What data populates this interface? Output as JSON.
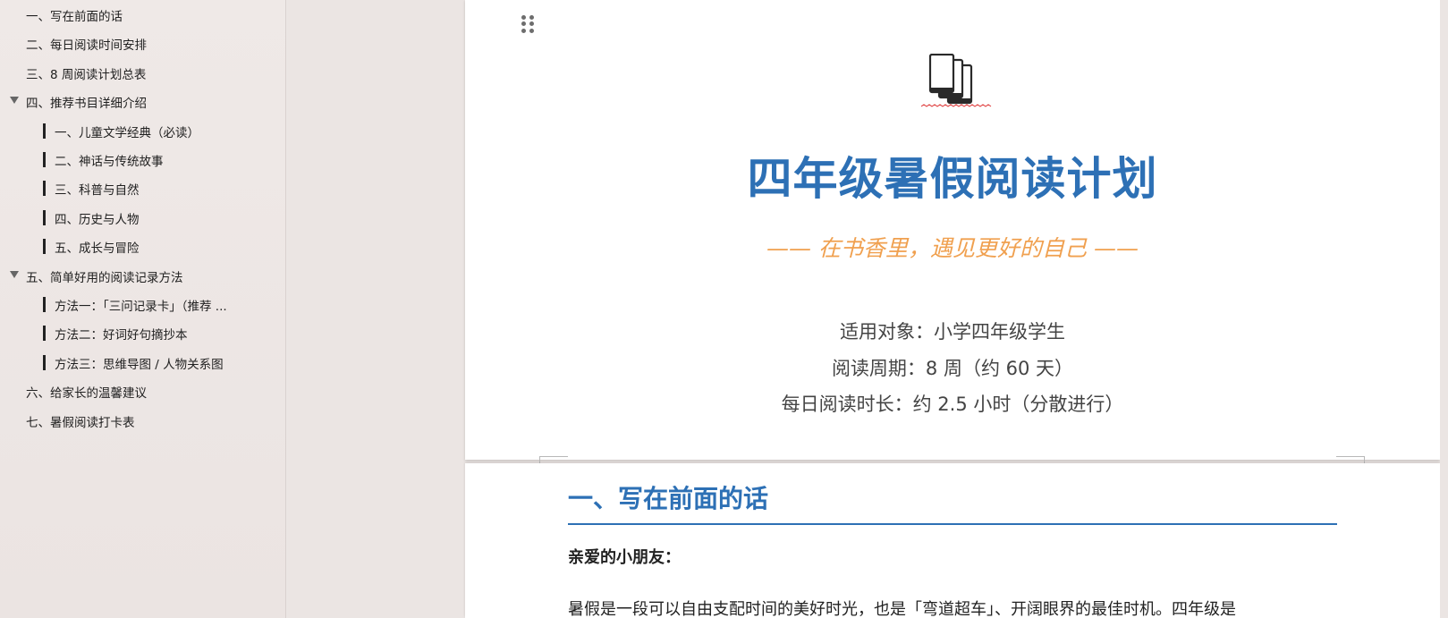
{
  "nav": {
    "items": [
      {
        "label": "一、写在前面的话",
        "level": 1,
        "expanded": null
      },
      {
        "label": "二、每日阅读时间安排",
        "level": 1,
        "expanded": null
      },
      {
        "label": "三、8 周阅读计划总表",
        "level": 1,
        "expanded": null
      },
      {
        "label": "四、推荐书目详细介绍",
        "level": 1,
        "expanded": true
      },
      {
        "label": "一、儿童文学经典（必读）",
        "level": 2,
        "expanded": null
      },
      {
        "label": "二、神话与传统故事",
        "level": 2,
        "expanded": null
      },
      {
        "label": "三、科普与自然",
        "level": 2,
        "expanded": null
      },
      {
        "label": "四、历史与人物",
        "level": 2,
        "expanded": null
      },
      {
        "label": "五、成长与冒险",
        "level": 2,
        "expanded": null
      },
      {
        "label": "五、简单好用的阅读记录方法",
        "level": 1,
        "expanded": true
      },
      {
        "label": "方法一：「三问记录卡」（推荐 ...",
        "level": 2,
        "expanded": null
      },
      {
        "label": "方法二：好词好句摘抄本",
        "level": 2,
        "expanded": null
      },
      {
        "label": "方法三：思维导图 / 人物关系图",
        "level": 2,
        "expanded": null
      },
      {
        "label": "六、给家长的温馨建议",
        "level": 1,
        "expanded": null
      },
      {
        "label": "七、暑假阅读打卡表",
        "level": 1,
        "expanded": null
      }
    ]
  },
  "cover": {
    "icon": "books-icon",
    "title": "四年级暑假阅读计划",
    "subtitle": "—— 在书香里，遇见更好的自己 ——",
    "info": [
      "适用对象：小学四年级学生",
      "阅读周期：8 周（约 60 天）",
      "每日阅读时长：约 2.5 小时（分散进行）"
    ]
  },
  "section1": {
    "heading": "一、写在前面的话",
    "greeting": "亲爱的小朋友：",
    "paragraph": "暑假是一段可以自由支配时间的美好时光，也是「弯道超车」、开阔眼界的最佳时机。四年级是"
  },
  "colors": {
    "accent": "#2d70b5",
    "subtitle": "#f0a04f",
    "nav_bg": "#ede7e5"
  }
}
